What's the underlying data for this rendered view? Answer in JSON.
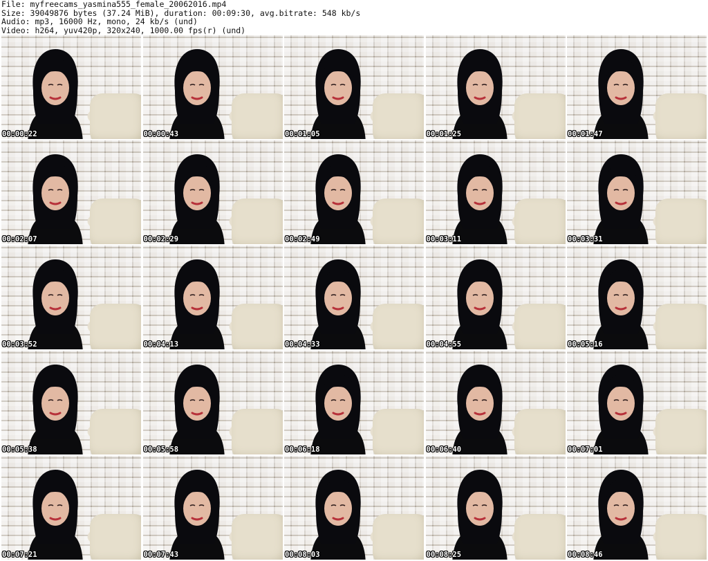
{
  "header": {
    "line1": "File: myfreecams_yasmina555_female_20062016.mp4",
    "line2": "Size: 39049876 bytes (37.24 MiB), duration: 00:09:30, avg.bitrate: 548 kb/s",
    "line3": "Audio: mp3, 16000 Hz, mono, 24 kb/s (und)",
    "line4": "Video: h264, yuv420p, 320x240, 1000.00 fps(r) (und)"
  },
  "thumbnails": [
    {
      "timestamp": "00:00:22"
    },
    {
      "timestamp": "00:00:43"
    },
    {
      "timestamp": "00:01:05"
    },
    {
      "timestamp": "00:01:25"
    },
    {
      "timestamp": "00:01:47"
    },
    {
      "timestamp": "00:02:07"
    },
    {
      "timestamp": "00:02:29"
    },
    {
      "timestamp": "00:02:49"
    },
    {
      "timestamp": "00:03:11"
    },
    {
      "timestamp": "00:03:31"
    },
    {
      "timestamp": "00:03:52"
    },
    {
      "timestamp": "00:04:13"
    },
    {
      "timestamp": "00:04:33"
    },
    {
      "timestamp": "00:04:55"
    },
    {
      "timestamp": "00:05:16"
    },
    {
      "timestamp": "00:05:38"
    },
    {
      "timestamp": "00:05:58"
    },
    {
      "timestamp": "00:06:18"
    },
    {
      "timestamp": "00:06:40"
    },
    {
      "timestamp": "00:07:01"
    },
    {
      "timestamp": "00:07:21"
    },
    {
      "timestamp": "00:07:43"
    },
    {
      "timestamp": "00:08:03"
    },
    {
      "timestamp": "00:08:25"
    },
    {
      "timestamp": "00:08:46"
    }
  ]
}
